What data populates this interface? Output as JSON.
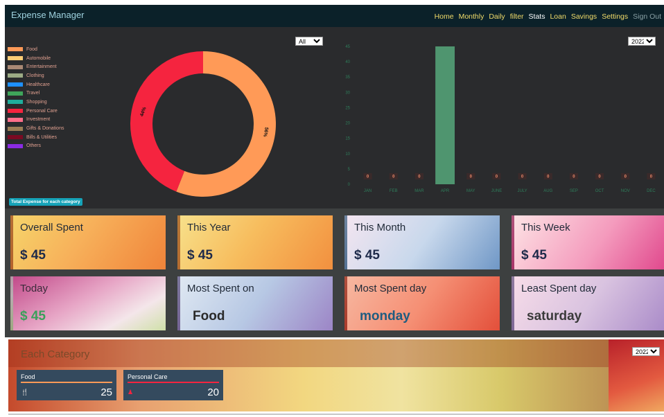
{
  "app": {
    "title": "Expense Manager"
  },
  "nav": {
    "items": [
      "Home",
      "Monthly",
      "Daily",
      "filter",
      "Stats",
      "Loan",
      "Savings",
      "Settings",
      "Sign Out"
    ]
  },
  "donut_filter": {
    "selected": "All"
  },
  "legend": {
    "items": [
      {
        "label": "Food",
        "color": "#ff9a57"
      },
      {
        "label": "Automobile",
        "color": "#ffcd75"
      },
      {
        "label": "Entertainment",
        "color": "#a98874"
      },
      {
        "label": "Clothing",
        "color": "#9cab85"
      },
      {
        "label": "Healthcare",
        "color": "#1e90ff"
      },
      {
        "label": "Travel",
        "color": "#3fa55a"
      },
      {
        "label": "Shopping",
        "color": "#1fae9c"
      },
      {
        "label": "Personal Care",
        "color": "#f5243f"
      },
      {
        "label": "Investment",
        "color": "#ff6f8a"
      },
      {
        "label": "Gifts & Donations",
        "color": "#9b7e55"
      },
      {
        "label": "Bills & Utilities",
        "color": "#7a0a22"
      },
      {
        "label": "Others",
        "color": "#8a2be2"
      }
    ]
  },
  "badge": {
    "label": "Total Expense for each category"
  },
  "chart_data": [
    {
      "type": "pie",
      "labels": [
        "Food",
        "Personal Care"
      ],
      "values": [
        56,
        44
      ],
      "data_labels": [
        "56%",
        "44%"
      ],
      "colors": [
        "#ff9a57",
        "#f5243f"
      ]
    },
    {
      "type": "bar",
      "categories": [
        "JAN",
        "FEB",
        "MAR",
        "APR",
        "MAY",
        "JUNE",
        "JULY",
        "AUG",
        "SEP",
        "OCT",
        "NOV",
        "DEC"
      ],
      "values": [
        0,
        0,
        0,
        45,
        0,
        0,
        0,
        0,
        0,
        0,
        0,
        0
      ],
      "data_labels": [
        "0",
        "0",
        "0",
        "",
        "0",
        "0",
        "0",
        "0",
        "0",
        "0",
        "0",
        "0"
      ],
      "yticks": [
        "0",
        "5",
        "10",
        "15",
        "20",
        "25",
        "30",
        "35",
        "40",
        "45"
      ],
      "ylim": [
        0,
        45
      ],
      "bar_color": "#4f956f",
      "year_selected": "2022"
    }
  ],
  "stats": {
    "cards": [
      {
        "title": "Overall Spent",
        "value": "$ 45"
      },
      {
        "title": "This Year",
        "value": "$ 45"
      },
      {
        "title": "This Month",
        "value": "$ 45"
      },
      {
        "title": "This Week",
        "value": "$ 45"
      },
      {
        "title": "Today",
        "value": "$ 45"
      },
      {
        "title": "Most Spent on",
        "value": "Food"
      },
      {
        "title": "Most Spent day",
        "value": "monday"
      },
      {
        "title": "Least Spent day",
        "value": "saturday"
      }
    ]
  },
  "category": {
    "title": "Each Category",
    "year_selected": "2022",
    "items": [
      {
        "name": "Food",
        "count": "25",
        "color": "#ff9a57",
        "icon": "utensils-icon"
      },
      {
        "name": "Personal Care",
        "count": "20",
        "color": "#f5243f",
        "icon": "person-icon"
      }
    ]
  }
}
